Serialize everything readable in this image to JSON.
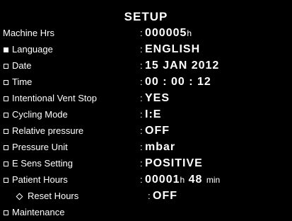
{
  "header": {
    "title": "SETUP"
  },
  "rows": [
    {
      "label": "Machine Hrs",
      "sep": ":",
      "value": "000005",
      "unit": "h"
    },
    {
      "label": "Language",
      "sep": ":",
      "value": "ENGLISH"
    },
    {
      "label": "Date",
      "sep": ":",
      "value": "15 JAN 2012"
    },
    {
      "label": "Time",
      "sep": ":",
      "value": "00 : 00 : 12"
    },
    {
      "label": "Intentional Vent Stop",
      "sep": ":",
      "value": "YES"
    },
    {
      "label": "Cycling Mode",
      "sep": ":",
      "value": "I:E"
    },
    {
      "label": "Relative pressure",
      "sep": ":",
      "value": "OFF"
    },
    {
      "label": "Pressure Unit",
      "sep": ":",
      "value": "mbar"
    },
    {
      "label": "E Sens Setting",
      "sep": ":",
      "value": "POSITIVE"
    },
    {
      "label": "Patient Hours",
      "sep": ":",
      "value": "00001",
      "unit": "h",
      "value2": "48",
      "unit2": "min"
    },
    {
      "label": "Reset Hours",
      "sep": ":",
      "value": "OFF"
    },
    {
      "label": "Maintenance"
    }
  ],
  "colors": {
    "background": "#000000",
    "text": "#ffffff"
  }
}
